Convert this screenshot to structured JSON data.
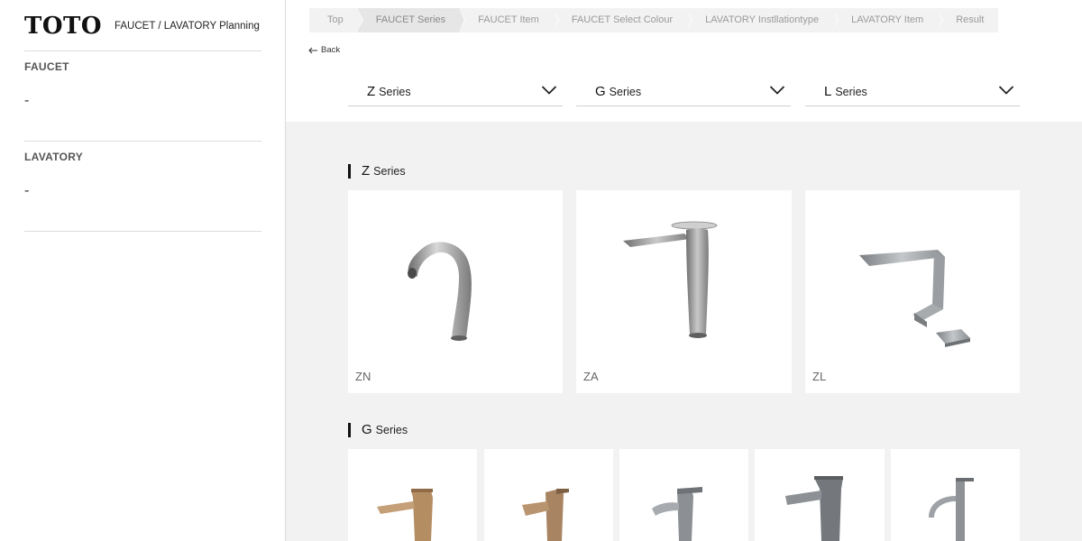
{
  "brand": {
    "logo": "TOTO",
    "subtitle": "FAUCET / LAVATORY Planning"
  },
  "sidebar": {
    "faucet": {
      "label": "FAUCET",
      "value": "-"
    },
    "lavatory": {
      "label": "LAVATORY",
      "value": "-"
    }
  },
  "breadcrumb": [
    "Top",
    "FAUCET Series",
    "FAUCET Item",
    "FAUCET Select Colour",
    "LAVATORY Instllationtype",
    "LAVATORY Item",
    "Result"
  ],
  "breadcrumb_active_index": 1,
  "back": {
    "label": "Back",
    "icon": "arrow-left-icon"
  },
  "selects": [
    {
      "letter": "Z",
      "word": "Series",
      "icon": "chevron-down-icon"
    },
    {
      "letter": "G",
      "word": "Series",
      "icon": "chevron-down-icon"
    },
    {
      "letter": "L",
      "word": "Series",
      "icon": "chevron-down-icon"
    }
  ],
  "sections": {
    "z": {
      "letter": "Z",
      "word": "Series",
      "items": [
        {
          "code": "ZN"
        },
        {
          "code": "ZA"
        },
        {
          "code": "ZL"
        }
      ]
    },
    "g": {
      "letter": "G",
      "word": "Series"
    }
  },
  "colors": {
    "sidebar_bg": "#ffffff",
    "main_bg": "#f2f2f2",
    "chrome": "#8c8c8c",
    "bronze": "#b08a62",
    "dark_chrome": "#6e7275"
  }
}
